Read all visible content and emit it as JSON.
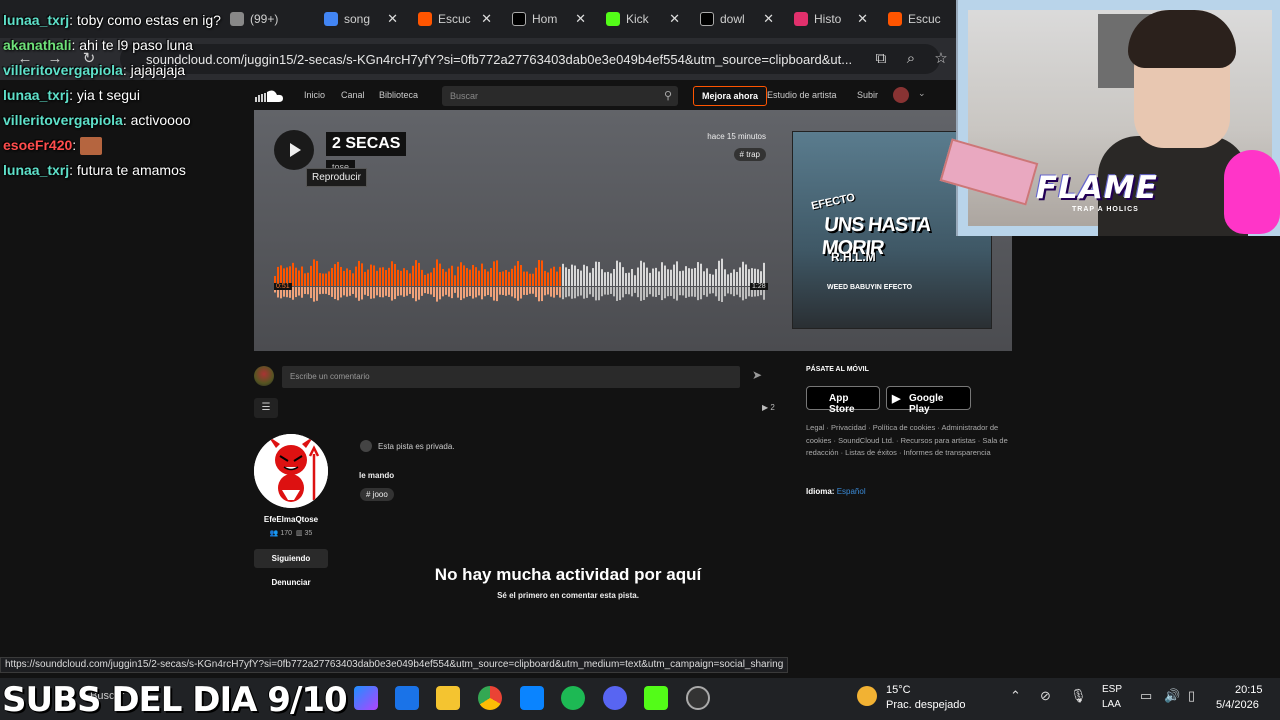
{
  "browser": {
    "tabs": [
      {
        "label": "(99+)",
        "color": "#888"
      },
      {
        "label": "song",
        "color": "#4285f4"
      },
      {
        "label": "Escuc",
        "color": "#ff5500"
      },
      {
        "label": "Hom",
        "color": "#000000"
      },
      {
        "label": "Kick",
        "color": "#53fc18"
      },
      {
        "label": "dowl",
        "color": "#000000"
      },
      {
        "label": "Histo",
        "color": "#e1306c"
      },
      {
        "label": "Escuc",
        "color": "#ff5500"
      }
    ],
    "url": "soundcloud.com/juggin15/2-secas/s-KGn4rcH7yfY?si=0fb772a27763403dab0e3e049b4ef554&utm_source=clipboard&ut...",
    "status_url": "https://soundcloud.com/juggin15/2-secas/s-KGn4rcH7yfY?si=0fb772a27763403dab0e3e049b4ef554&utm_source=clipboard&utm_medium=text&utm_campaign=social_sharing"
  },
  "sc": {
    "nav": {
      "home": "Inicio",
      "feed": "Canal",
      "library": "Biblioteca",
      "search_placeholder": "Buscar",
      "upgrade": "Mejora ahora",
      "artist_studio": "Estudio de artista",
      "upload": "Subir"
    },
    "track": {
      "title": "2 SECAS",
      "artist": "tose",
      "tooltip": "Reproducir",
      "posted": "hace 15 minutos",
      "tag": "# trap",
      "time_elapsed": "0:51",
      "time_total": "1:28",
      "progress": 0.58,
      "cover_lines": [
        "EFECTO",
        "UNS HASTA MORIR",
        "R.H.L.M",
        "WEED  BABUYIN  EFECTO"
      ]
    },
    "comment_placeholder": "Escribe un comentario",
    "plays": "▶ 2",
    "artist": {
      "name": "EfeElmaQtose",
      "followers": "170",
      "tracks": "35",
      "follow_label": "Siguiendo",
      "report_label": "Denunciar"
    },
    "private_note": "Esta pista es privada.",
    "description": "le mando",
    "desc_tag": "# jooo",
    "empty_title": "No hay mucha actividad por aquí",
    "empty_sub": "Sé el primero en comentar esta pista.",
    "sidebar": {
      "mobile_title": "PÁSATE AL MÓVIL",
      "app_store": "App Store",
      "google_play": "Google Play",
      "footer_links": "Legal · Privacidad · Política de cookies · Administrador de cookies · SoundCloud Ltd. · Recursos para artistas · Sala de redacción · Listas de éxitos · Informes de transparencia",
      "language_label": "Idioma:",
      "language_value": "Español"
    }
  },
  "chat": [
    {
      "user": "lunaa_txrj",
      "color": "#5ee0c9",
      "msg": "toby como estas en ig?"
    },
    {
      "user": "akanathali",
      "color": "#6fe27a",
      "msg": "ahi te l9 paso luna"
    },
    {
      "user": "villeritovergapiola",
      "color": "#5ee0c9",
      "msg": "jajajajaja"
    },
    {
      "user": "lunaa_txrj",
      "color": "#5ee0c9",
      "msg": "yia t segui"
    },
    {
      "user": "villeritovergapiola",
      "color": "#5ee0c9",
      "msg": "activoooo"
    },
    {
      "user": "esoeFr420",
      "color": "#ff4d4d",
      "msg": ""
    },
    {
      "user": "lunaa_txrj",
      "color": "#5ee0c9",
      "msg": "futura te amamos"
    }
  ],
  "overlay": {
    "logo": "FLAME",
    "logo_sub": "TRAP A HOLICS",
    "banner": "SUBS DEL DIA 9/10"
  },
  "taskbar": {
    "search": "Buscar",
    "weather_temp": "15°C",
    "weather_desc": "Prac. despejado",
    "lang1": "ESP",
    "lang2": "LAA",
    "time": "20:15",
    "date": "5/4/2026"
  },
  "colors": {
    "accent": "#ff5500",
    "waveform_played": "#ff5500",
    "waveform_unplayed": "#d8d8d8"
  }
}
